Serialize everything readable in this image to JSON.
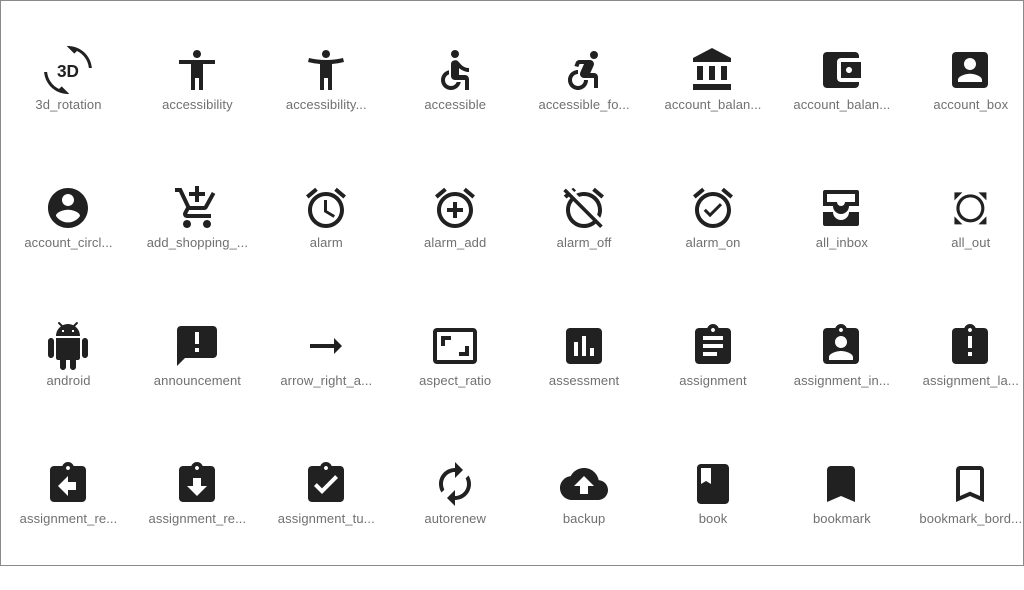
{
  "icon_color": "#212121",
  "label_color": "#707070",
  "icons": [
    {
      "name": "3d_rotation",
      "label": "3d_rotation",
      "glyph_text": "3D"
    },
    {
      "name": "accessibility",
      "label": "accessibility"
    },
    {
      "name": "accessibility_new",
      "label": "accessibility..."
    },
    {
      "name": "accessible",
      "label": "accessible"
    },
    {
      "name": "accessible_forward",
      "label": "accessible_fo..."
    },
    {
      "name": "account_balance",
      "label": "account_balan..."
    },
    {
      "name": "account_balance_wallet",
      "label": "account_balan..."
    },
    {
      "name": "account_box",
      "label": "account_box"
    },
    {
      "name": "account_circle",
      "label": "account_circl..."
    },
    {
      "name": "add_shopping_cart",
      "label": "add_shopping_..."
    },
    {
      "name": "alarm",
      "label": "alarm"
    },
    {
      "name": "alarm_add",
      "label": "alarm_add"
    },
    {
      "name": "alarm_off",
      "label": "alarm_off"
    },
    {
      "name": "alarm_on",
      "label": "alarm_on"
    },
    {
      "name": "all_inbox",
      "label": "all_inbox"
    },
    {
      "name": "all_out",
      "label": "all_out"
    },
    {
      "name": "android",
      "label": "android"
    },
    {
      "name": "announcement",
      "label": "announcement"
    },
    {
      "name": "arrow_right_alt",
      "label": "arrow_right_a..."
    },
    {
      "name": "aspect_ratio",
      "label": "aspect_ratio"
    },
    {
      "name": "assessment",
      "label": "assessment"
    },
    {
      "name": "assignment",
      "label": "assignment"
    },
    {
      "name": "assignment_ind",
      "label": "assignment_in..."
    },
    {
      "name": "assignment_late",
      "label": "assignment_la..."
    },
    {
      "name": "assignment_return",
      "label": "assignment_re..."
    },
    {
      "name": "assignment_returned",
      "label": "assignment_re..."
    },
    {
      "name": "assignment_turned_in",
      "label": "assignment_tu..."
    },
    {
      "name": "autorenew",
      "label": "autorenew"
    },
    {
      "name": "backup",
      "label": "backup"
    },
    {
      "name": "book",
      "label": "book"
    },
    {
      "name": "bookmark",
      "label": "bookmark"
    },
    {
      "name": "bookmark_border",
      "label": "bookmark_bord..."
    }
  ]
}
